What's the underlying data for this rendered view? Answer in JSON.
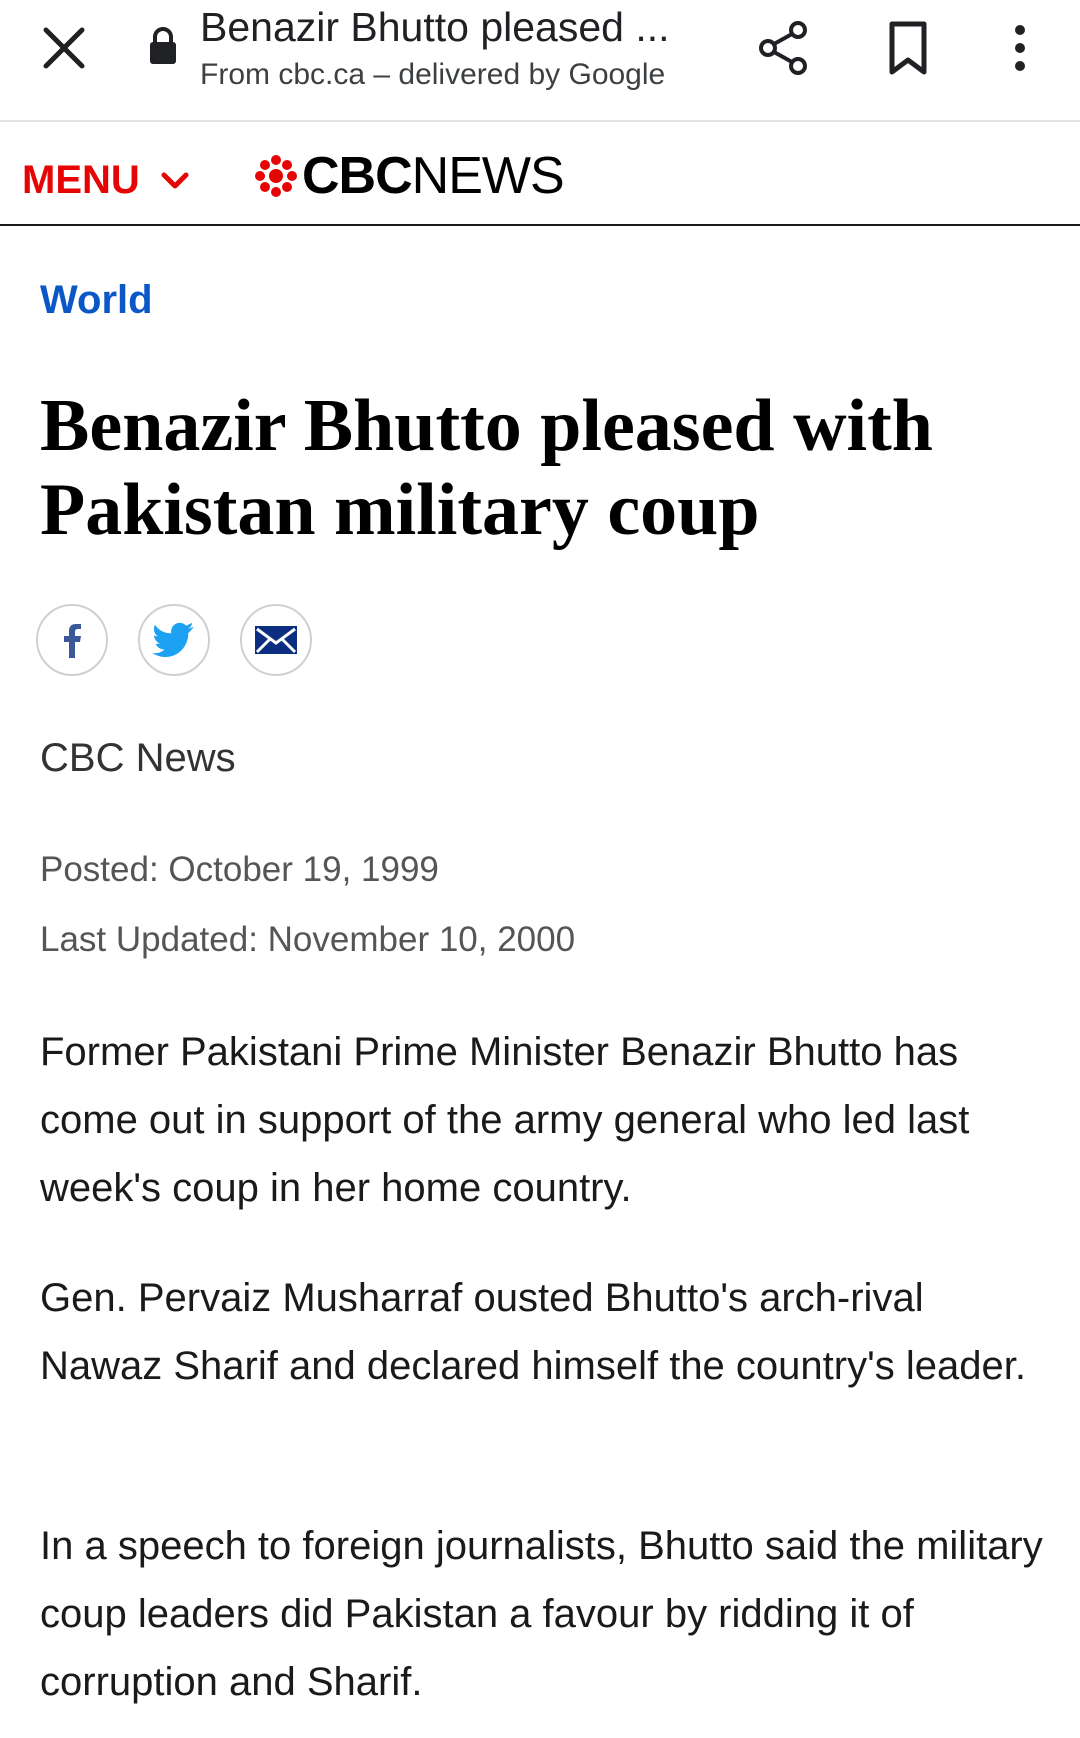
{
  "viewer": {
    "title": "Benazir Bhutto pleased ...",
    "subtitle": "From cbc.ca – delivered by Google"
  },
  "header": {
    "menu_label": "MENU",
    "logo_cbc": "CBC",
    "logo_news": "NEWS"
  },
  "article": {
    "section": "World",
    "headline": "Benazir Bhutto pleased with Pakistan military coup",
    "byline": "CBC News",
    "posted": "Posted: October 19, 1999",
    "updated": "Last Updated: November 10, 2000",
    "paragraphs": [
      "Former Pakistani Prime Minister Benazir Bhutto has come out in support of the army general who led last week's coup in her home country.",
      "Gen. Pervaiz Musharraf ousted Bhutto's arch-rival Nawaz Sharif and declared himself the country's leader.",
      "In a speech to foreign journalists, Bhutto said the military coup leaders did Pakistan a favour by ridding it of corruption and Sharif."
    ]
  },
  "colors": {
    "brand_red": "#e60505",
    "section_blue": "#0b57c7",
    "facebook_blue": "#3b5998",
    "twitter_blue": "#1da1f2"
  },
  "icons": [
    "close-icon",
    "lock-icon",
    "share-icon",
    "bookmark-icon",
    "more-vert-icon",
    "chevron-down-icon",
    "cbc-gem-icon",
    "facebook-icon",
    "twitter-icon",
    "email-icon"
  ]
}
